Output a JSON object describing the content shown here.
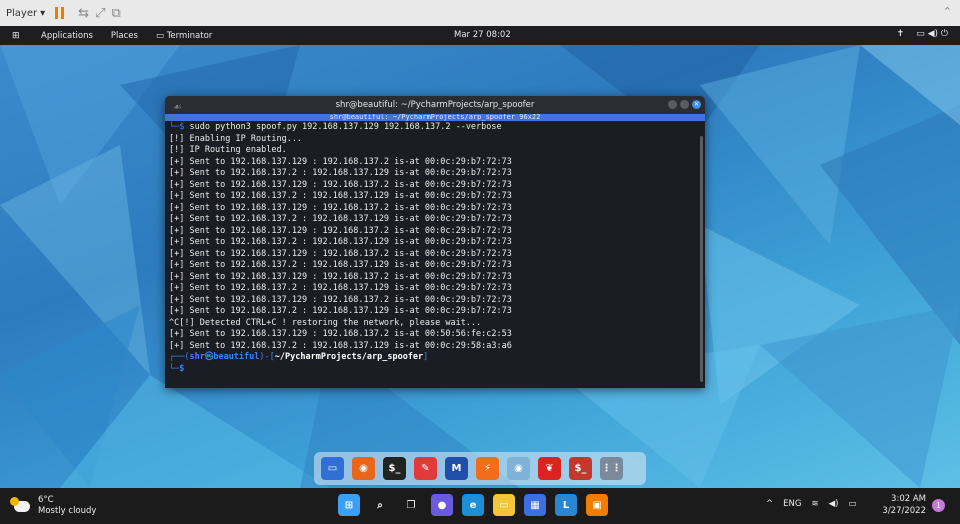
{
  "player": {
    "menu_label": "Player",
    "menu_arrow": "▾",
    "icons": [
      "send-ctrl-alt-del-icon",
      "fit-window-icon",
      "unity-mode-icon"
    ],
    "collapse": "⌃"
  },
  "gnome_panel": {
    "applications": "Applications",
    "places": "Places",
    "terminal_app": "Terminator",
    "clock": "Mar 27  08:02"
  },
  "terminal": {
    "title": "shr@beautiful: ~/PycharmProjects/arp_spoofer",
    "tab_label": "shr@beautiful: ~/PycharmProjects/arp_spoofer 96x22",
    "lines": [
      "└─$ sudo python3 spoof.py 192.168.137.129 192.168.137.2 --verbose",
      "[!] Enabling IP Routing...",
      "[!] IP Routing enabled.",
      "[+] Sent to 192.168.137.129 : 192.168.137.2 is-at 00:0c:29:b7:72:73",
      "[+] Sent to 192.168.137.2 : 192.168.137.129 is-at 00:0c:29:b7:72:73",
      "[+] Sent to 192.168.137.129 : 192.168.137.2 is-at 00:0c:29:b7:72:73",
      "[+] Sent to 192.168.137.2 : 192.168.137.129 is-at 00:0c:29:b7:72:73",
      "[+] Sent to 192.168.137.129 : 192.168.137.2 is-at 00:0c:29:b7:72:73",
      "[+] Sent to 192.168.137.2 : 192.168.137.129 is-at 00:0c:29:b7:72:73",
      "[+] Sent to 192.168.137.129 : 192.168.137.2 is-at 00:0c:29:b7:72:73",
      "[+] Sent to 192.168.137.2 : 192.168.137.129 is-at 00:0c:29:b7:72:73",
      "[+] Sent to 192.168.137.129 : 192.168.137.2 is-at 00:0c:29:b7:72:73",
      "[+] Sent to 192.168.137.2 : 192.168.137.129 is-at 00:0c:29:b7:72:73",
      "[+] Sent to 192.168.137.129 : 192.168.137.2 is-at 00:0c:29:b7:72:73",
      "[+] Sent to 192.168.137.2 : 192.168.137.129 is-at 00:0c:29:b7:72:73",
      "[+] Sent to 192.168.137.129 : 192.168.137.2 is-at 00:0c:29:b7:72:73",
      "[+] Sent to 192.168.137.2 : 192.168.137.129 is-at 00:0c:29:b7:72:73",
      "^C[!] Detected CTRL+C ! restoring the network, please wait...",
      "[+] Sent to 192.168.137.129 : 192.168.137.2 is-at 00:50:56:fe:c2:53",
      "[+] Sent to 192.168.137.2 : 192.168.137.129 is-at 00:0c:29:58:a3:a6"
    ],
    "prompt": {
      "prefix": "┌──(",
      "user_host": "shr㉿beautiful",
      "mid": ")-[",
      "path": "~/PycharmProjects/arp_spoofer",
      "suffix": "]",
      "second": "└─",
      "dollar": "$"
    }
  },
  "dock": {
    "items": [
      {
        "name": "files-icon",
        "color": "#2f6fd6",
        "glyph": "▭"
      },
      {
        "name": "firefox-icon",
        "color": "#e8671d",
        "glyph": "◉"
      },
      {
        "name": "terminal-icon",
        "color": "#222",
        "glyph": "$_"
      },
      {
        "name": "text-editor-icon",
        "color": "#e23a3a",
        "glyph": "✎"
      },
      {
        "name": "metasploit-icon",
        "color": "#1f4fa8",
        "glyph": "M"
      },
      {
        "name": "burpsuite-icon",
        "color": "#f26c1a",
        "glyph": "⚡"
      },
      {
        "name": "eye-icon",
        "color": "#7fb2d6",
        "glyph": "◉"
      },
      {
        "name": "cherrytree-icon",
        "color": "#d22",
        "glyph": "❦"
      },
      {
        "name": "kali-terminal-icon",
        "color": "#c0392b",
        "glyph": "$_"
      },
      {
        "name": "show-apps-icon",
        "color": "#7a8a9a",
        "glyph": "⋮⋮"
      }
    ]
  },
  "taskbar": {
    "temperature": "6°C",
    "condition": "Mostly cloudy",
    "apps": [
      {
        "name": "windows-start-icon",
        "color": "#3aa0f5",
        "glyph": "⊞"
      },
      {
        "name": "search-icon",
        "color": "#1b1b1b",
        "glyph": "⌕"
      },
      {
        "name": "task-view-icon",
        "color": "#1b1b1b",
        "glyph": "❐"
      },
      {
        "name": "teams-chat-icon",
        "color": "#6a5ae0",
        "glyph": "●"
      },
      {
        "name": "edge-icon",
        "color": "#1c8fd8",
        "glyph": "e"
      },
      {
        "name": "file-explorer-icon",
        "color": "#f3c53b",
        "glyph": "▭"
      },
      {
        "name": "store-icon",
        "color": "#3d6fe0",
        "glyph": "▦"
      },
      {
        "name": "l-app-icon",
        "color": "#2a86d0",
        "glyph": "L"
      },
      {
        "name": "vmware-icon",
        "color": "#f07c00",
        "glyph": "▣"
      }
    ],
    "tray": {
      "chevron": "^",
      "language": "ENG",
      "wifi": "wifi-icon",
      "volume": "volume-icon",
      "battery": "battery-icon"
    },
    "time": "3:02 AM",
    "date": "3/27/2022",
    "notification_count": "1"
  }
}
